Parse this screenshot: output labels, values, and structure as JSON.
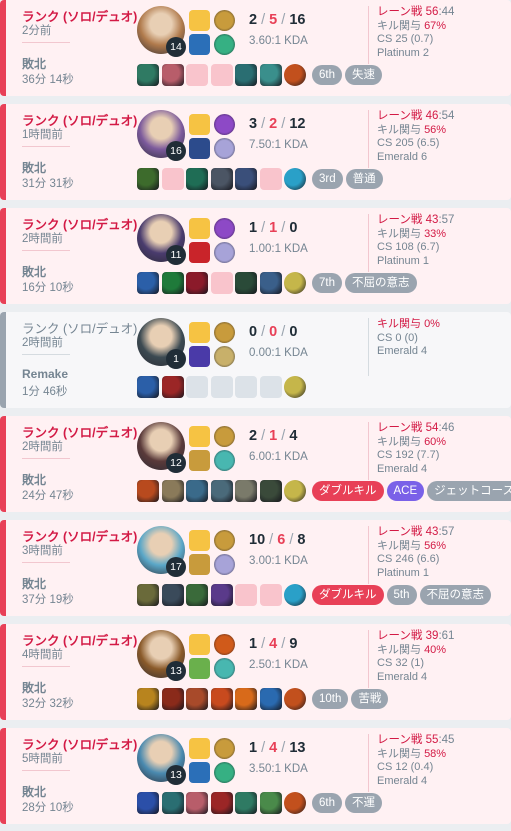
{
  "matches": [
    {
      "type": "loss",
      "queue": "ランク (ソロ/デュオ)",
      "ago": "2分前",
      "result": "敗北",
      "duration": "36分 14秒",
      "champion_level": "14",
      "kda": {
        "k": "2",
        "d": "5",
        "a": "16"
      },
      "kda_ratio": "3.60:1 KDA",
      "lane": {
        "label": "レーン戦",
        "us": "56",
        "them": "44"
      },
      "kill_participation": {
        "label": "キル関与",
        "value": "67%"
      },
      "cs": "CS 25 (0.7)",
      "tier": "Platinum 2",
      "badges": [
        {
          "text": "6th",
          "kind": "plain"
        },
        {
          "text": "失速",
          "kind": "plain"
        }
      ],
      "champion_color": "#b07a4c",
      "spell_colors": [
        "#f6c343",
        "#2b6fb8"
      ],
      "rune_colors": [
        "#c89b3c",
        "#36b083"
      ],
      "item_colors": [
        "#2f7a63",
        "#b85d6a",
        "#f9c4cc",
        "#f9c4cc",
        "#2a6e72",
        "#3a8f8c",
        "#c2501d"
      ]
    },
    {
      "type": "loss",
      "queue": "ランク (ソロ/デュオ)",
      "ago": "1時間前",
      "result": "敗北",
      "duration": "31分 31秒",
      "champion_level": "16",
      "kda": {
        "k": "3",
        "d": "2",
        "a": "12"
      },
      "kda_ratio": "7.50:1 KDA",
      "lane": {
        "label": "レーン戦",
        "us": "46",
        "them": "54"
      },
      "kill_participation": {
        "label": "キル関与",
        "value": "56%"
      },
      "cs": "CS 205 (6.5)",
      "tier": "Emerald 6",
      "badges": [
        {
          "text": "3rd",
          "kind": "plain"
        },
        {
          "text": "普通",
          "kind": "plain"
        }
      ],
      "champion_color": "#7c5a9c",
      "spell_colors": [
        "#f6c343",
        "#2c4b8c"
      ],
      "rune_colors": [
        "#8d49c6",
        "#a7a3d8"
      ],
      "item_colors": [
        "#3d6b2c",
        "#f9c4cc",
        "#1f6d55",
        "#4b5564",
        "#3a4f7a",
        "#f9c4cc",
        "#2aa0c8"
      ]
    },
    {
      "type": "loss",
      "queue": "ランク (ソロ/デュオ)",
      "ago": "2時間前",
      "result": "敗北",
      "duration": "16分 10秒",
      "champion_level": "11",
      "kda": {
        "k": "1",
        "d": "1",
        "a": "0"
      },
      "kda_ratio": "1.00:1 KDA",
      "lane": {
        "label": "レーン戦",
        "us": "43",
        "them": "57"
      },
      "kill_participation": {
        "label": "キル関与",
        "value": "33%"
      },
      "cs": "CS 108 (6.7)",
      "tier": "Platinum 1",
      "badges": [
        {
          "text": "7th",
          "kind": "plain"
        },
        {
          "text": "不屈の意志",
          "kind": "plain"
        }
      ],
      "champion_color": "#4a3c6e",
      "spell_colors": [
        "#f6c343",
        "#c9242a"
      ],
      "rune_colors": [
        "#8d49c6",
        "#a7a3d8"
      ],
      "item_colors": [
        "#2b5fa8",
        "#1f7a3a",
        "#8b1a2a",
        "#f9c4cc",
        "#2a4a38",
        "#3a5f8a",
        "#c5b64a"
      ]
    },
    {
      "type": "remake",
      "queue": "ランク (ソロ/デュオ)",
      "ago": "2時間前",
      "result": "Remake",
      "duration": "1分 46秒",
      "champion_level": "1",
      "kda": {
        "k": "0",
        "d": "0",
        "a": "0"
      },
      "kda_ratio": "0.00:1 KDA",
      "kill_participation": {
        "label": "キル関与",
        "value": "0%"
      },
      "cs": "CS 0 (0)",
      "tier": "Emerald 4",
      "badges": [],
      "champion_color": "#3c4a52",
      "spell_colors": [
        "#f6c343",
        "#4a3aa8"
      ],
      "rune_colors": [
        "#c89b3c",
        "#c8b06a"
      ],
      "item_colors": [
        "#2b5fa8",
        "#9b2626",
        "#dce2e8",
        "#dce2e8",
        "#dce2e8",
        "#dce2e8",
        "#c5b64a"
      ]
    },
    {
      "type": "loss",
      "queue": "ランク (ソロ/デュオ)",
      "ago": "2時間前",
      "result": "敗北",
      "duration": "24分 47秒",
      "champion_level": "12",
      "kda": {
        "k": "2",
        "d": "1",
        "a": "4"
      },
      "kda_ratio": "6.00:1 KDA",
      "lane": {
        "label": "レーン戦",
        "us": "54",
        "them": "46"
      },
      "kill_participation": {
        "label": "キル関与",
        "value": "60%"
      },
      "cs": "CS 192 (7.7)",
      "tier": "Emerald 4",
      "badges": [
        {
          "text": "ダブルキル",
          "kind": "multi"
        },
        {
          "text": "ACE",
          "kind": "ace"
        },
        {
          "text": "ジェットコースター",
          "kind": "plain"
        }
      ],
      "champion_color": "#5a3a3a",
      "spell_colors": [
        "#f6c343",
        "#c89b3c"
      ],
      "rune_colors": [
        "#c89b3c",
        "#48b7b0"
      ],
      "item_colors": [
        "#b84a1e",
        "#8a7a5a",
        "#3a6a8a",
        "#4a6a7a",
        "#7a7a6a",
        "#3a4a3a",
        "#c5b64a"
      ]
    },
    {
      "type": "loss",
      "queue": "ランク (ソロ/デュオ)",
      "ago": "3時間前",
      "result": "敗北",
      "duration": "37分 19秒",
      "champion_level": "17",
      "kda": {
        "k": "10",
        "d": "6",
        "a": "8"
      },
      "kda_ratio": "3.00:1 KDA",
      "lane": {
        "label": "レーン戦",
        "us": "43",
        "them": "57"
      },
      "kill_participation": {
        "label": "キル関与",
        "value": "56%"
      },
      "cs": "CS 246 (6.6)",
      "tier": "Platinum 1",
      "badges": [
        {
          "text": "ダブルキル",
          "kind": "multi"
        },
        {
          "text": "5th",
          "kind": "plain"
        },
        {
          "text": "不屈の意志",
          "kind": "plain"
        }
      ],
      "champion_color": "#5aa7c8",
      "spell_colors": [
        "#f6c343",
        "#c89b3c"
      ],
      "rune_colors": [
        "#c89b3c",
        "#a7a3d8"
      ],
      "item_colors": [
        "#6a6a3a",
        "#3a4a5a",
        "#3a6a3a",
        "#5a3a8a",
        "#f9c4cc",
        "#f9c4cc",
        "#2aa0c8"
      ]
    },
    {
      "type": "loss",
      "queue": "ランク (ソロ/デュオ)",
      "ago": "4時間前",
      "result": "敗北",
      "duration": "32分 32秒",
      "champion_level": "13",
      "kda": {
        "k": "1",
        "d": "4",
        "a": "9"
      },
      "kda_ratio": "2.50:1 KDA",
      "lane": {
        "label": "レーン戦",
        "us": "39",
        "them": "61"
      },
      "kill_participation": {
        "label": "キル関与",
        "value": "40%"
      },
      "cs": "CS 32 (1)",
      "tier": "Emerald 4",
      "badges": [
        {
          "text": "10th",
          "kind": "plain"
        },
        {
          "text": "苦戦",
          "kind": "plain"
        }
      ],
      "champion_color": "#8a5a2a",
      "spell_colors": [
        "#f6c343",
        "#6ab04c"
      ],
      "rune_colors": [
        "#d05a1a",
        "#48b7b0"
      ],
      "item_colors": [
        "#b8841e",
        "#8a2a1a",
        "#a84a2a",
        "#c84a1e",
        "#d86a1a",
        "#2a6ab0",
        "#c2501d"
      ]
    },
    {
      "type": "loss",
      "queue": "ランク (ソロ/デュオ)",
      "ago": "5時間前",
      "result": "敗北",
      "duration": "28分 10秒",
      "champion_level": "13",
      "kda": {
        "k": "1",
        "d": "4",
        "a": "13"
      },
      "kda_ratio": "3.50:1 KDA",
      "lane": {
        "label": "レーン戦",
        "us": "55",
        "them": "45"
      },
      "kill_participation": {
        "label": "キル関与",
        "value": "58%"
      },
      "cs": "CS 12 (0.4)",
      "tier": "Emerald 4",
      "badges": [
        {
          "text": "6th",
          "kind": "plain"
        },
        {
          "text": "不運",
          "kind": "plain"
        }
      ],
      "champion_color": "#4a8ab0",
      "spell_colors": [
        "#f6c343",
        "#2b6fb8"
      ],
      "rune_colors": [
        "#c89b3c",
        "#36b083"
      ],
      "item_colors": [
        "#2b4fa8",
        "#2a6e72",
        "#b85d6a",
        "#9b2626",
        "#2f7a63",
        "#4a8a4a",
        "#c2501d"
      ]
    }
  ]
}
